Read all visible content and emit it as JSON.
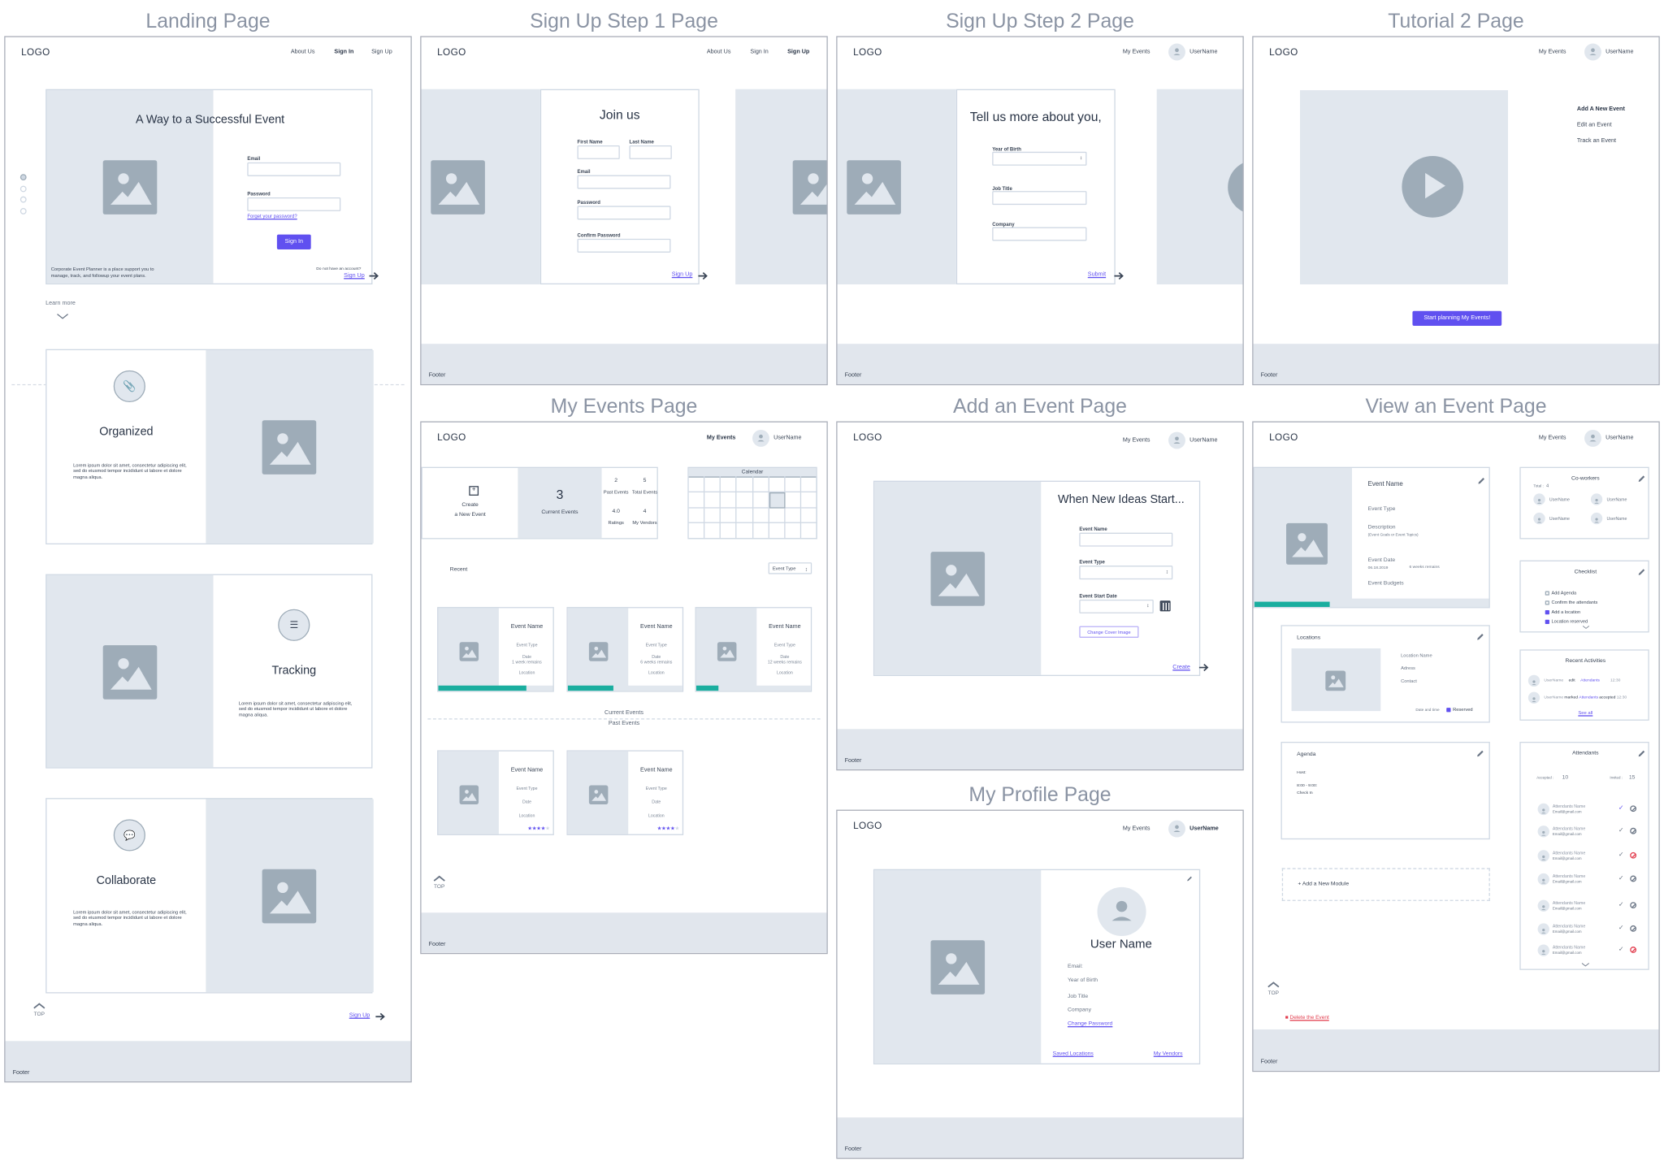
{
  "colors": {
    "accent": "#6050f0",
    "progress": "#1aae9f",
    "danger": "#e23d4e",
    "placeholder": "#e1e7ee",
    "frame": "#a9adb8"
  },
  "landing": {
    "title": "Landing Page",
    "logo": "LOGO",
    "nav": [
      "About Us",
      "Sign In",
      "Sign Up"
    ],
    "active_nav": "Sign In",
    "hero_title": "A Way to a Successful Event",
    "email_label": "Email",
    "password_label": "Password",
    "forgot_link": "Forget your password?",
    "signin_button": "Sign In",
    "tagline_1": "Corporate Event Planner is a place support  you to",
    "tagline_2": "manage, track, and followup your event plans.",
    "no_account": "Do not have an account?",
    "signup_link": "Sign Up",
    "learn_more": "Learn more",
    "features": [
      {
        "title": "Organized",
        "icon": "paperclip-icon",
        "text": "Lorem ipsum dolor sit amet, consectetur adipiscing elit, sed do eiusmod tempor incididunt ut labore et dolore magna aliqua."
      },
      {
        "title": "Tracking",
        "icon": "list-icon",
        "text": "Lorem ipsum dolor sit amet, consectetur adipiscing elit, sed do eiusmod tempor incididunt ut labore et dolore magna aliqua."
      },
      {
        "title": "Collaborate",
        "icon": "chat-icon",
        "text": "Lorem ipsum dolor sit amet, consectetur adipiscing elit, sed do eiusmod tempor incididunt ut labore et dolore magna aliqua."
      }
    ],
    "carousel_dots": 4,
    "top": "TOP",
    "bottom_signup": "Sign Up",
    "footer": "Footer"
  },
  "signup1": {
    "title": "Sign Up Step 1 Page",
    "logo": "LOGO",
    "nav": [
      "About Us",
      "Sign In",
      "Sign Up"
    ],
    "active_nav": "Sign Up",
    "heading": "Join us",
    "first_name": "First Name",
    "last_name": "Last Name",
    "email": "Email",
    "password": "Password",
    "confirm_password": "Confirm Password",
    "submit": "Sign Up",
    "footer": "Footer"
  },
  "signup2": {
    "title": "Sign Up Step 2 Page",
    "logo": "LOGO",
    "my_events": "My Events",
    "username": "UserName",
    "heading": "Tell us more about you,",
    "year_of_birth": "Year of Birth",
    "job_title": "Job Title",
    "company": "Company",
    "submit": "Submit",
    "footer": "Footer"
  },
  "tutorial": {
    "title": "Tutorial 2 Page",
    "logo": "LOGO",
    "my_events": "My Events",
    "username": "UserName",
    "steps": [
      "Add A New Event",
      "Edit an Event",
      "Track an Event"
    ],
    "active_step": "Add A New Event",
    "button": "Start planning My Events!",
    "footer": "Footer"
  },
  "my_events": {
    "title": "My Events Page",
    "logo": "LOGO",
    "my_events": "My Events",
    "username": "UserName",
    "create_1": "Create",
    "create_2": "a New Event",
    "current_count": "3",
    "current_label": "Current Events",
    "stats": [
      {
        "value": "2",
        "label": "Past Events"
      },
      {
        "value": "5",
        "label": "Total Events"
      },
      {
        "value": "4.0",
        "label": "Ratings"
      },
      {
        "value": "4",
        "label": "My Vendors"
      }
    ],
    "calendar_title": "Calendar",
    "recent": "Recent",
    "filter": "Event Type",
    "current_events": [
      {
        "name": "Event Name",
        "type": "Event Type",
        "date": "Date",
        "remains": "1 week remains",
        "location": "Location",
        "progress": 0.77
      },
      {
        "name": "Event Name",
        "type": "Event Type",
        "date": "Date",
        "remains": "6 weeks remains",
        "location": "Location",
        "progress": 0.4
      },
      {
        "name": "Event Name",
        "type": "Event Type",
        "date": "Date",
        "remains": "12 weeks remains",
        "location": "Location",
        "progress": 0.19
      }
    ],
    "divider_top": "Current Events",
    "divider_bottom": "Past Events",
    "past_events": [
      {
        "name": "Event Name",
        "type": "Event Type",
        "date": "Date",
        "location": "Location",
        "rating": 4,
        "rating_max": 5
      },
      {
        "name": "Event Name",
        "type": "Event Type",
        "date": "Date",
        "location": "Location",
        "rating": 4,
        "rating_max": 5
      }
    ],
    "top": "TOP",
    "footer": "Footer"
  },
  "add_event": {
    "title": "Add an Event Page",
    "logo": "LOGO",
    "my_events": "My Events",
    "username": "UserName",
    "heading": "When New Ideas Start...",
    "event_name": "Event Name",
    "event_type": "Event Type",
    "start_date": "Event Start Date",
    "change_cover": "Change Cover Image",
    "create": "Create",
    "footer": "Footer"
  },
  "profile": {
    "title": "My Profile Page",
    "logo": "LOGO",
    "my_events": "My Events",
    "username": "UserName",
    "name": "User Name",
    "fields": [
      "Email:",
      "Year of Birth",
      "Job Title",
      "Company"
    ],
    "change_password": "Change Password",
    "saved_locations": "Saved Locations",
    "my_vendors": "My Vendors",
    "footer": "Footer"
  },
  "view_event": {
    "title": "View an Event Page",
    "logo": "LOGO",
    "my_events": "My Events",
    "username": "UserName",
    "event_name": "Event Name",
    "event_type": "Event Type",
    "description": "Description",
    "description_hint": "(Event Goals or Event Topics)",
    "event_date": "Event Date",
    "date_value": "06.18.2019",
    "remains": "6 weeks remains",
    "budgets": "Event Budgets",
    "progress": 0.32,
    "coworkers": {
      "title": "Co-workers",
      "total_label": "Total :",
      "total": "4",
      "users": [
        "UserName",
        "UserName",
        "UserName",
        "UserName"
      ]
    },
    "checklist": {
      "title": "Checklist",
      "items": [
        {
          "label": "Add Agenda",
          "checked": false
        },
        {
          "label": "Confirm the attendants",
          "checked": false
        },
        {
          "label": "Add a location",
          "checked": true
        },
        {
          "label": "Location reserved",
          "checked": true
        }
      ]
    },
    "activities": {
      "title": "Recent Activities",
      "rows": [
        {
          "user": "UserName",
          "action": "edit",
          "target": "Attendants",
          "extra": "",
          "time": "12:30"
        },
        {
          "user": "UserName",
          "action": "marked",
          "target": "Attendants",
          "extra": "accepted",
          "time": "12:30"
        }
      ],
      "see_all": "See all"
    },
    "locations": {
      "title": "Locations",
      "name": "Location Name",
      "address": "Adress",
      "contact": "Contact",
      "date_time": "Date and time",
      "reserved": "Reserved",
      "reserved_checked": true
    },
    "agenda": {
      "title": "Agenda",
      "host": "Host:",
      "time": "8:00 - 9:00:",
      "item": "Check In"
    },
    "add_module": "+ Add a New Module",
    "attendants": {
      "title": "Attendants",
      "accepted_label": "Accepted :",
      "accepted": "10",
      "invited_label": "Invited :",
      "invited": "15",
      "rows": [
        {
          "name": "Attendants Name",
          "email": "Email@gmail.com",
          "status": "accepted"
        },
        {
          "name": "Attendants Name",
          "email": "Email@gmail.com",
          "status": "pending"
        },
        {
          "name": "Attendants Name",
          "email": "Email@gmail.com",
          "status": "declined"
        },
        {
          "name": "Attendants Name",
          "email": "Email@gmail.com",
          "status": "pending"
        },
        {
          "name": "Attendants Name",
          "email": "Email@gmail.com",
          "status": "pending"
        },
        {
          "name": "Attendants Name",
          "email": "Email@gmail.com",
          "status": "pending"
        },
        {
          "name": "Attendants Name",
          "email": "Email@gmail.com",
          "status": "declined"
        }
      ]
    },
    "top": "TOP",
    "delete": "Delete the Event",
    "footer": "Footer"
  }
}
